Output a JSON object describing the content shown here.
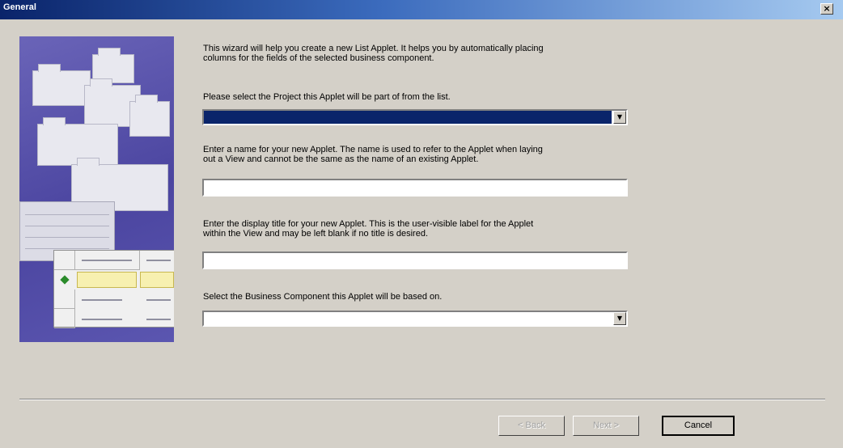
{
  "window": {
    "title": "General",
    "close_glyph": "×"
  },
  "intro": {
    "line1": "This wizard will help you create a new List Applet.  It helps you by automatically placing",
    "line2": "columns for the fields of the selected business component."
  },
  "project": {
    "label": "Please select the Project this Applet will be part of from the list.",
    "value": ""
  },
  "name": {
    "label_line1": "Enter a name for your new Applet. The name is used to refer to the Applet when laying",
    "label_line2": "out a View and cannot be the same as the name of an existing Applet.",
    "value": ""
  },
  "display_title": {
    "label_line1": "Enter the display title for your new Applet. This is the user-visible label for the Applet",
    "label_line2": "within the View and may be left blank if no title is desired.",
    "value": ""
  },
  "business_component": {
    "label": "Select the Business Component this Applet will be based on.",
    "value": ""
  },
  "dropdown_glyph": "▼",
  "buttons": {
    "back": "< Back",
    "next": "Next >",
    "cancel": "Cancel"
  },
  "colors": {
    "titlebar_start": "#0a246a",
    "titlebar_end": "#a6caf0",
    "dialog_bg": "#d4d0c8",
    "selection": "#0a246a",
    "illustration_bg": "#4b45a0"
  },
  "icons": [
    "close-icon",
    "dropdown-arrow-icon",
    "folders-illustration"
  ]
}
